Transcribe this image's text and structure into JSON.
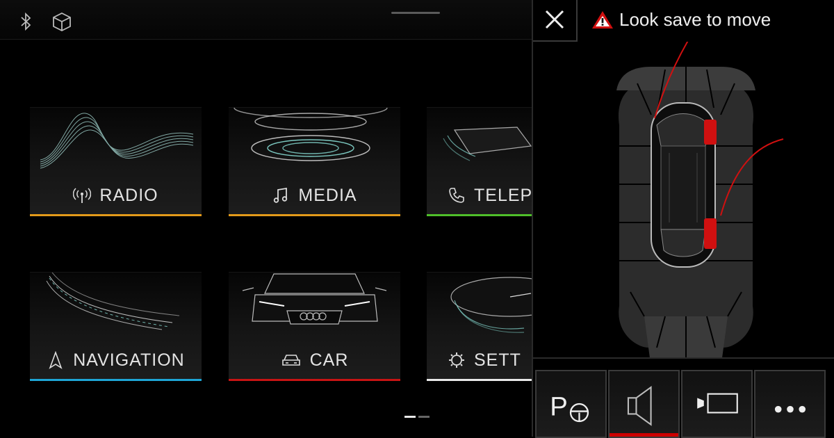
{
  "statusbar": {
    "icons": [
      "bluetooth-icon",
      "3d-cube-icon"
    ]
  },
  "home": {
    "tiles": [
      {
        "label": "RADIO",
        "icon": "radio-antenna-icon",
        "accent": "#e39a1a"
      },
      {
        "label": "MEDIA",
        "icon": "music-note-icon",
        "accent": "#e39a1a"
      },
      {
        "label": "TELEP",
        "icon": "phone-icon",
        "accent": "#4fbf2a"
      },
      {
        "label": "NAVIGATION",
        "icon": "navigation-arrow-icon",
        "accent": "#1ea6d6"
      },
      {
        "label": "CAR",
        "icon": "car-icon",
        "accent": "#c81414"
      },
      {
        "label": "SETT",
        "icon": "settings-gear-icon",
        "accent": "#e8e8e8"
      }
    ],
    "pager": {
      "pages": 2,
      "current": 1
    }
  },
  "parking": {
    "warning": "Look save to move",
    "warning_icon": "warning-triangle-icon",
    "close_icon": "close-icon",
    "buttons": [
      {
        "name": "park-steering",
        "icon": "park-steering-icon",
        "active": false
      },
      {
        "name": "sound",
        "icon": "speaker-icon",
        "active": true
      },
      {
        "name": "camera",
        "icon": "rear-camera-icon",
        "active": false
      },
      {
        "name": "more",
        "icon": "more-dots-icon",
        "active": false
      }
    ],
    "colors": {
      "alert": "#d01010",
      "sector": "#444444"
    }
  }
}
